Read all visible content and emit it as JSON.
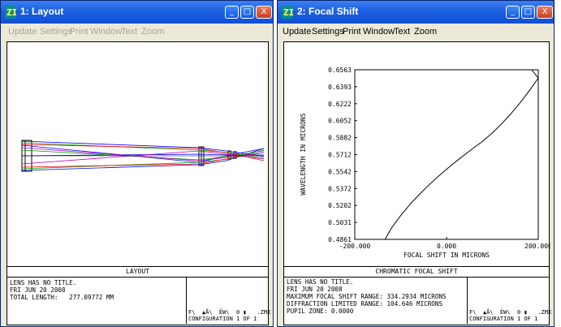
{
  "windows": [
    {
      "title": "1: Layout",
      "menu": [
        "Update",
        "Settings",
        "Print",
        "Window",
        "Text",
        "Zoom"
      ],
      "menu_enabled": false,
      "info": {
        "heading": "LAYOUT",
        "line1": "LENS HAS NO TITLE.",
        "line2": "FRI JUN 20 2008",
        "line3": "TOTAL LENGTH:   277.09772 MM",
        "cfg_line1": "F\\  ▲Å\\  ËW\\  0 ▮   .ZMX",
        "cfg_line2": "CONFIGURATION 1 OF 1"
      }
    },
    {
      "title": "2: Focal Shift",
      "menu": [
        "Update",
        "Settings",
        "Print",
        "Window",
        "Text",
        "Zoom"
      ],
      "menu_enabled": true,
      "info": {
        "heading": "CHROMATIC FOCAL SHIFT",
        "line1": "LENS HAS NO TITLE.",
        "line2": "FRI JUN 20 2008",
        "line3": "MAXIMUM FOCAL SHIFT RANGE: 334.2934 MICRONS",
        "line4": "DIFFRACTION LIMITED RANGE: 104.646 MICRONS",
        "line5": "PUPIL ZONE: 0.0000",
        "cfg_line1": "F\\  ▲Å\\  ËW\\  0 ▮   .ZMX",
        "cfg_line2": "CONFIGURATION 1 OF 1"
      }
    }
  ],
  "window_buttons": {
    "minimize": "_",
    "maximize": "□",
    "close": "X"
  },
  "icons": {
    "app": "zemax-app-icon"
  },
  "colors": {
    "title_bar": "#1c5fe0",
    "ray_blue": "#0000ff",
    "ray_green": "#00a000",
    "ray_red": "#ff0000",
    "ray_magenta": "#c000c0"
  },
  "chart_data": {
    "type": "line",
    "xlabel": "FOCAL SHIFT IN MICRONS",
    "ylabel": "WAVELENGTH IN MICRONS",
    "xlim": [
      -200,
      200
    ],
    "ylim": [
      0.4861,
      0.6563
    ],
    "x_ticks": [
      "-200.000",
      "0.000",
      "200.000"
    ],
    "y_ticks": [
      "0.6563",
      "0.6393",
      "0.6222",
      "0.6052",
      "0.5882",
      "0.5712",
      "0.5542",
      "0.5372",
      "0.5202",
      "0.5031",
      "0.4861"
    ],
    "grid": false,
    "series": [
      {
        "x": [
          -134,
          -120,
          -100,
          -80,
          -60,
          -40,
          -20,
          0,
          20,
          40,
          60,
          80,
          100,
          120,
          140,
          160,
          180,
          200
        ],
        "y": [
          0.4861,
          0.4975,
          0.51,
          0.521,
          0.5308,
          0.54,
          0.5485,
          0.5565,
          0.564,
          0.5712,
          0.5782,
          0.585,
          0.593,
          0.602,
          0.612,
          0.623,
          0.635,
          0.648
        ]
      }
    ]
  }
}
